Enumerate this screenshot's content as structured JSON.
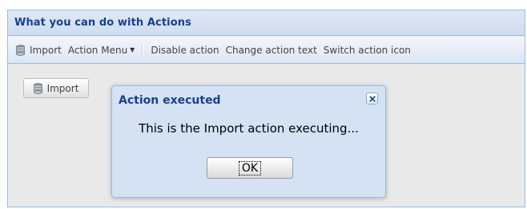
{
  "panel": {
    "title": "What you can do with Actions"
  },
  "toolbar": {
    "import_label": "Import",
    "action_menu_label": "Action Menu",
    "disable_label": "Disable action",
    "change_text_label": "Change action text",
    "switch_icon_label": "Switch action icon"
  },
  "body": {
    "import_button_label": "Import"
  },
  "dialog": {
    "title": "Action executed",
    "message": "This is the Import action executing...",
    "ok_label": "OK"
  },
  "icons": {
    "import": "database-icon",
    "close": "close-icon",
    "dropdown": "chevron-down-icon"
  },
  "colors": {
    "title_text": "#15428b",
    "panel_border": "#99bbe8",
    "dialog_bg": "#d4e2f4"
  }
}
